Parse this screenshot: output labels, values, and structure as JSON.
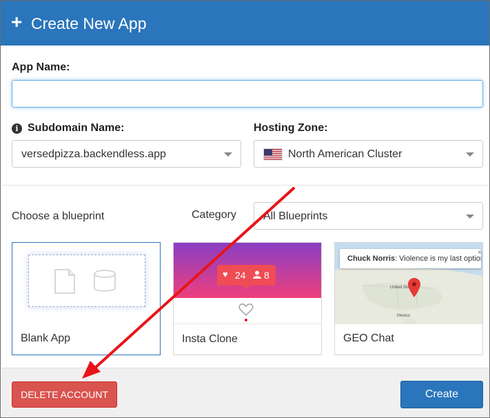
{
  "header": {
    "title": "Create New App",
    "icon": "plus-icon"
  },
  "form": {
    "app_name_label": "App Name:",
    "app_name_value": "",
    "subdomain_label": "Subdomain Name:",
    "subdomain_value": "versedpizza.backendless.app",
    "hosting_label": "Hosting Zone:",
    "hosting_value": "North American Cluster"
  },
  "blueprints": {
    "choose_label": "Choose a blueprint",
    "category_label": "Category",
    "category_value": "All Blueprints",
    "cards": [
      {
        "label": "Blank App"
      },
      {
        "label": "Insta Clone",
        "likes": "24",
        "followers": "8"
      },
      {
        "label": "GEO Chat",
        "popup_name": "Chuck Norris",
        "popup_text": ": Violence is my last option",
        "map_labels": [
          "United States",
          "Mexico"
        ]
      }
    ]
  },
  "footer": {
    "delete_label": "DELETE ACCOUNT",
    "create_label": "Create"
  },
  "colors": {
    "primary": "#2a75bb",
    "danger": "#d9534f",
    "annotation": "#e8141a"
  }
}
